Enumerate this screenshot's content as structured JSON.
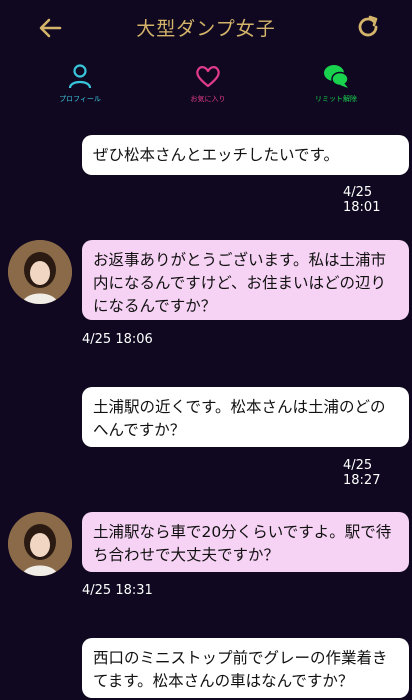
{
  "header": {
    "title": "大型ダンプ女子"
  },
  "actions": {
    "profile": "プロフィール",
    "favorite": "お気に入り",
    "limit_release": "リミット解除"
  },
  "colors": {
    "background": "#0f0820",
    "title": "#d4b46a",
    "profile": "#39c6dc",
    "favorite": "#e03a8c",
    "limit_release": "#19d34f",
    "her_bubble": "#f6d2f4",
    "my_bubble": "#ffffff"
  },
  "messages": [
    {
      "from": "me",
      "text": "ぜひ松本さんとエッチしたいです。",
      "time": "4/25 18:01"
    },
    {
      "from": "her",
      "text": "お返事ありがとうございます。私は土浦市内になるんですけど、お住まいはどの辺りになるんですか？",
      "time": "4/25 18:06"
    },
    {
      "from": "me",
      "text": "土浦駅の近くです。松本さんは土浦のどのへんですか？",
      "time": "4/25 18:27"
    },
    {
      "from": "her",
      "text": "土浦駅なら車で20分くらいですよ。駅で待ち合わせで大丈夫ですか？",
      "time": "4/25 18:31"
    },
    {
      "from": "me",
      "text": "西口のミニストップ前でグレーの作業着きてます。松本さんの車はなんですか？",
      "time": ""
    }
  ]
}
